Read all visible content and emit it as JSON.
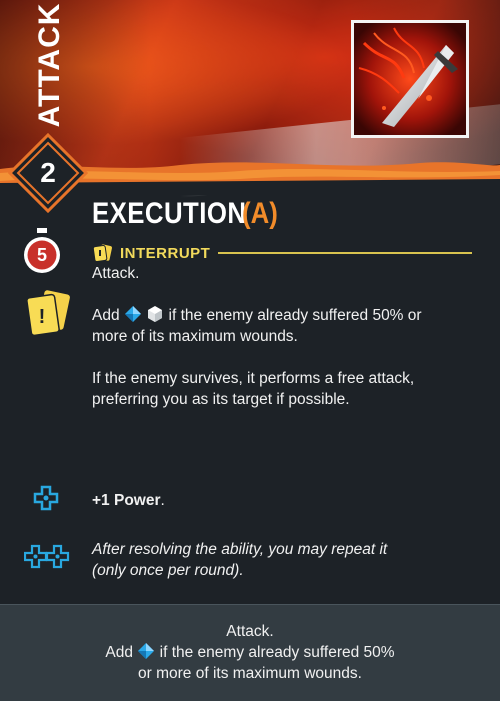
{
  "card": {
    "category": "ATTACK",
    "cost": "2",
    "title": "EXECUTION",
    "title_suffix": "(A)",
    "timer": "5",
    "interrupt_label": "INTERRUPT",
    "lines": {
      "l1": "Attack.",
      "l2a": "Add",
      "l2b": "if the enemy already suffered 50% or",
      "l3": "more of its maximum wounds.",
      "l4": "If the enemy survives, it performs a free attack,",
      "l5": "preferring you as its target if possible."
    },
    "modifiers": {
      "power_bold": "+1 Power",
      "power_rest": ".",
      "repeat_1": "After resolving the ability, you may repeat it",
      "repeat_2": "(only once per round)."
    },
    "footer": {
      "f1": "Attack.",
      "f2a": "Add",
      "f2b": "if the enemy already suffered 50%",
      "f3": "or more of its maximum wounds."
    },
    "colors": {
      "accent_orange": "#f28c2a",
      "interrupt_yellow": "#f2da5c",
      "timer_red": "#c8302a",
      "modifier_blue": "#29a8e0",
      "background": "#1d2227",
      "footer_bg": "#333c42"
    },
    "icons": [
      "dagger-icon",
      "timer-icon",
      "reaction-cards-icon",
      "blue-die-icon",
      "white-die-icon",
      "plus-icon",
      "double-plus-icon"
    ]
  }
}
